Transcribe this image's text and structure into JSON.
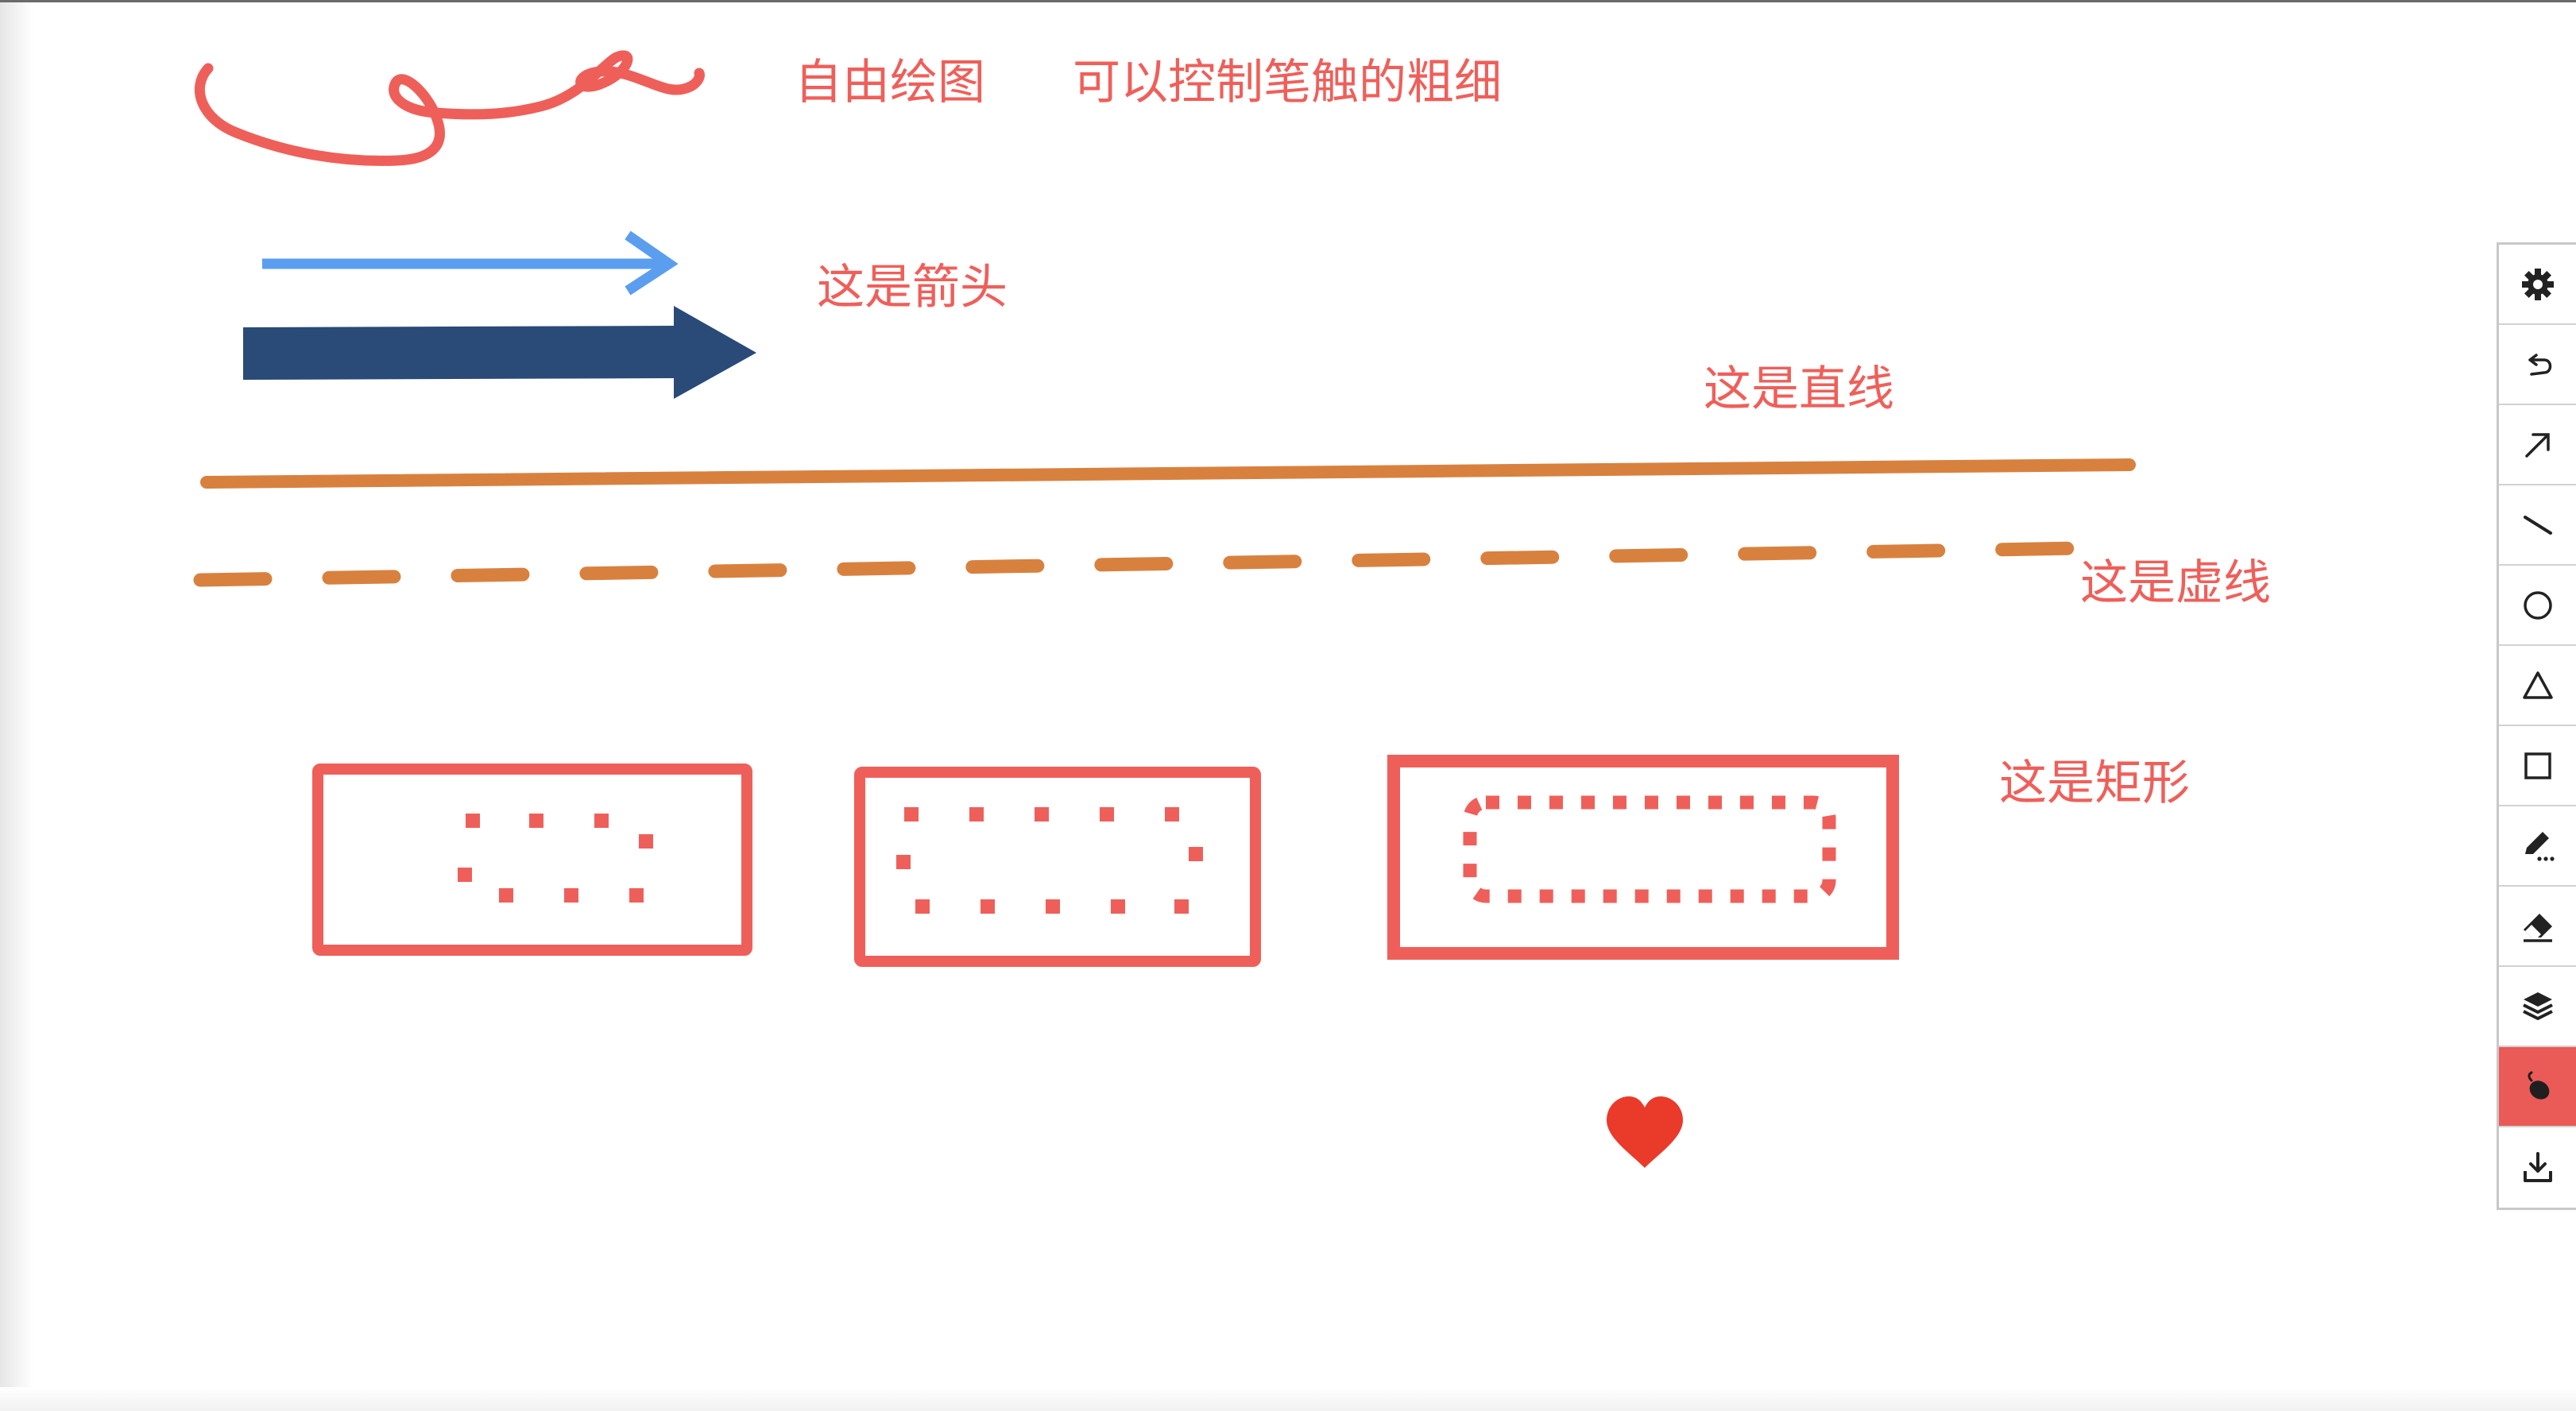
{
  "canvas": {
    "background": "#ffffff",
    "labels": {
      "freehand": "自由绘图",
      "thickness": "可以控制笔触的粗细",
      "arrow": "这是箭头",
      "line": "这是直线",
      "dashed": "这是虚线",
      "rectangle": "这是矩形"
    },
    "colors": {
      "label": "#ef5f5a",
      "freehand_stroke": "#ef5f5a",
      "thin_arrow": "#5b9ef0",
      "thick_arrow": "#2a4a78",
      "line": "#d8813f",
      "rectangle": "#ef5f5a",
      "heart": "#ea3a2a"
    },
    "shapes": [
      "freehand",
      "thin-arrow",
      "thick-arrow",
      "straight-line",
      "dashed-line",
      "rectangle",
      "rectangle",
      "rectangle",
      "heart"
    ]
  },
  "toolbar": {
    "accent": "#ea5a56",
    "tools": [
      {
        "name": "settings",
        "icon": "gear-icon",
        "active": false
      },
      {
        "name": "undo",
        "icon": "undo-icon",
        "active": false
      },
      {
        "name": "arrow",
        "icon": "arrow-icon",
        "active": false
      },
      {
        "name": "line",
        "icon": "line-icon",
        "active": false
      },
      {
        "name": "circle",
        "icon": "circle-icon",
        "active": false
      },
      {
        "name": "triangle",
        "icon": "triangle-icon",
        "active": false
      },
      {
        "name": "rectangle",
        "icon": "square-icon",
        "active": false
      },
      {
        "name": "pencil",
        "icon": "pencil-icon",
        "active": false
      },
      {
        "name": "eraser",
        "icon": "eraser-icon",
        "active": false
      },
      {
        "name": "layers",
        "icon": "layers-icon",
        "active": false
      },
      {
        "name": "mouse",
        "icon": "mouse-icon",
        "active": true
      },
      {
        "name": "download",
        "icon": "download-icon",
        "active": false
      }
    ]
  }
}
